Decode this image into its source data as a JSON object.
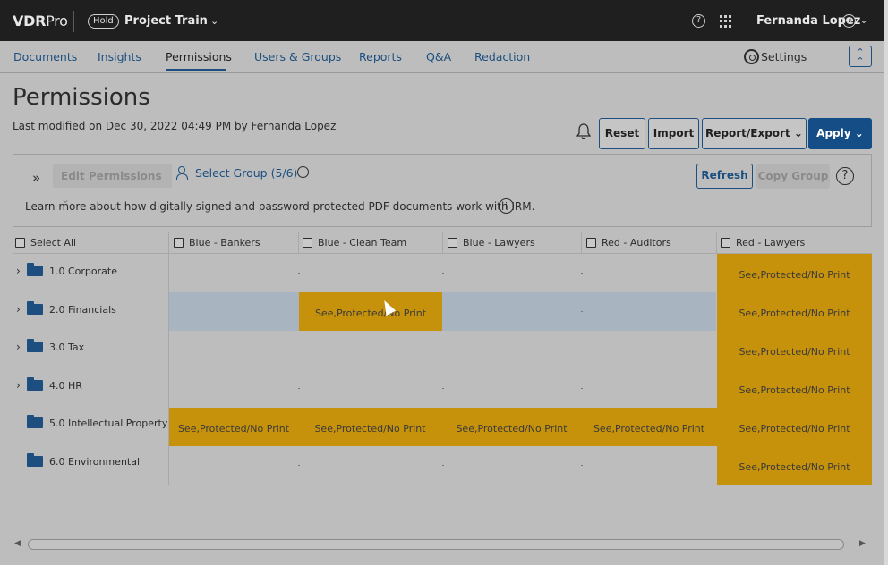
{
  "topbar": {
    "brand_bold": "VDR",
    "brand_rest": "Pro",
    "hold_badge": "Hold",
    "project": "Project Train",
    "help_glyph": "?",
    "user": "Fernanda Lopez"
  },
  "nav": {
    "items": [
      "Documents",
      "Insights",
      "Permissions",
      "Users & Groups",
      "Reports",
      "Q&A",
      "Redaction"
    ],
    "active": "Permissions",
    "settings": "Settings"
  },
  "header": {
    "title": "Permissions",
    "last_modified": "Last modified on Dec 30, 2022 04:49 PM by Fernanda Lopez",
    "buttons": {
      "reset": "Reset",
      "import": "Import",
      "report_export": "Report/Export",
      "apply": "Apply"
    }
  },
  "toolbar": {
    "edit_permissions": "Edit Permissions",
    "select_group": "Select Group (5/6)",
    "refresh": "Refresh",
    "copy_group": "Copy Group",
    "learn_more": "Learn more about how digitally signed and password protected PDF documents work with IRM.",
    "info_glyph": "i",
    "help_glyph": "?"
  },
  "grid": {
    "select_all": "Select All",
    "columns": [
      "Blue - Bankers",
      "Blue - Clean Team",
      "Blue - Lawyers",
      "Red - Auditors",
      "Red - Lawyers"
    ],
    "rows": [
      {
        "label": "1.0 Corporate",
        "expandable": true,
        "cells": [
          "",
          "",
          "",
          "",
          "See,Protected/No Print"
        ]
      },
      {
        "label": "2.0 Financials",
        "expandable": true,
        "cells": [
          "",
          "See,Protected/No Print",
          "",
          "",
          "See,Protected/No Print"
        ]
      },
      {
        "label": "3.0 Tax",
        "expandable": true,
        "cells": [
          "",
          "",
          "",
          "",
          "See,Protected/No Print"
        ]
      },
      {
        "label": "4.0 HR",
        "expandable": true,
        "cells": [
          "",
          "",
          "",
          "",
          "See,Protected/No Print"
        ]
      },
      {
        "label": "5.0 Intellectual Property",
        "expandable": false,
        "cells": [
          "See,Protected/No Print",
          "See,Protected/No Print",
          "See,Protected/No Print",
          "See,Protected/No Print",
          "See,Protected/No Print"
        ]
      },
      {
        "label": "6.0 Environmental",
        "expandable": false,
        "cells": [
          "",
          "",
          "",
          "",
          "See,Protected/No Print"
        ]
      }
    ]
  },
  "colors": {
    "topbar_bg": "#1f1f1f",
    "accent": "#1c4f80",
    "apply_bg": "#154e86",
    "permission_cell": "#c6920b",
    "selected_row": "#a8b4bf",
    "overlay_bg": "#bdbdbd"
  }
}
